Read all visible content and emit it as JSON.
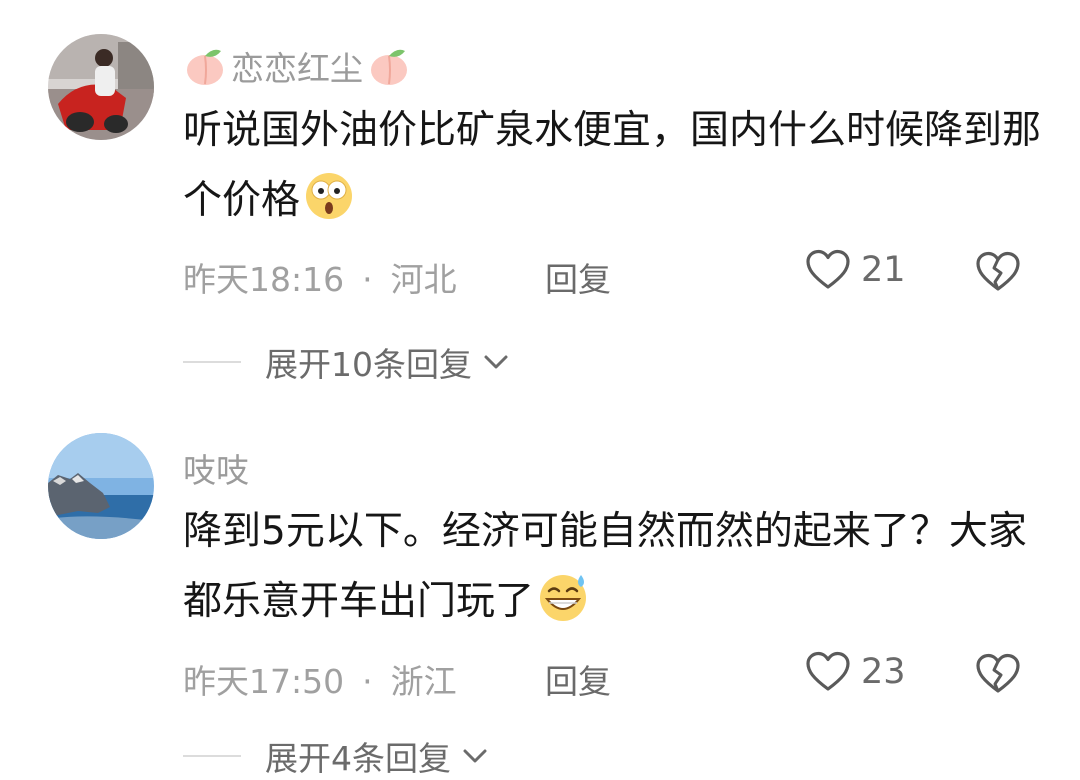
{
  "comments": [
    {
      "username": "恋恋红尘",
      "text": "听说国外油价比矿泉水便宜，国内什么时候降到那个价格",
      "time": "昨天18:16",
      "separator": "·",
      "location": "河北",
      "reply_label": "回复",
      "likes": "21",
      "expand_label": "展开10条回复"
    },
    {
      "username": "吱吱",
      "text": "降到5元以下。经济可能自然而然的起来了？大家都乐意开车出门玩了",
      "time": "昨天17:50",
      "separator": "·",
      "location": "浙江",
      "reply_label": "回复",
      "likes": "23",
      "expand_label": "展开4条回复"
    }
  ],
  "icons": {
    "like": "heart-outline-icon",
    "dislike": "broken-heart-icon",
    "expand": "chevron-down-icon",
    "username_decoration": "peach-icon",
    "emoji_1": "shocked-face-emoji",
    "emoji_2": "sweat-grin-emoji"
  },
  "colors": {
    "text": "#161616",
    "meta": "#a0a0a0",
    "action": "#6a6a6a"
  }
}
